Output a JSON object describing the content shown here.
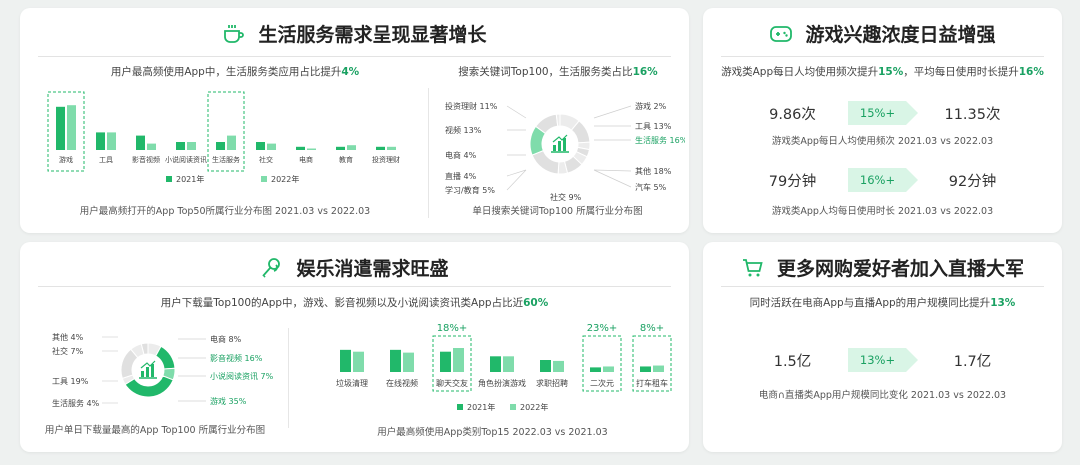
{
  "cards": {
    "services": {
      "title": "生活服务需求呈现显著增长",
      "left_sub_prefix": "用户最高频使用App中，生活服务类应用占比提升",
      "left_sub_highlight": "4%",
      "right_sub_prefix": "搜索关键词Top100，生活服务类占比",
      "right_sub_highlight": "16%",
      "left_caption": "用户最高频打开的App Top50所属行业分布图   2021.03 vs 2022.03",
      "right_caption": "单日搜索关键词Top100 所属行业分布图"
    },
    "games": {
      "title": "游戏兴趣浓度日益增强",
      "sub_prefix1": "游戏类App每日人均使用频次提升",
      "sub_highlight1": "15%",
      "sub_prefix2": "，平均每日使用时长提升",
      "sub_highlight2": "16%",
      "stat1": {
        "from": "9.86次",
        "pct": "15%+",
        "to": "11.35次",
        "caption": "游戏类App每日人均使用频次   2021.03 vs 2022.03"
      },
      "stat2": {
        "from": "79分钟",
        "pct": "16%+",
        "to": "92分钟",
        "caption": "游戏类App人均每日使用时长   2021.03 vs 2022.03"
      }
    },
    "entertainment": {
      "title": "娱乐消遣需求旺盛",
      "sub_prefix": "用户下载量Top100的App中，游戏、影音视频以及小说阅读资讯类App占比近",
      "sub_highlight": "60%",
      "left_caption": "用户单日下载量最高的App Top100 所属行业分布图",
      "right_caption": "用户最高频使用App类别Top15   2022.03 vs 2021.03"
    },
    "livestream": {
      "title": "更多网购爱好者加入直播大军",
      "sub_prefix": "同时活跃在电商App与直播App的用户规模同比提升",
      "sub_highlight": "13%",
      "stat": {
        "from": "1.5亿",
        "pct": "13%+",
        "to": "1.7亿",
        "caption": "电商∩直播类App用户规模同比变化   2021.03 vs 2022.03"
      }
    }
  },
  "colors": {
    "dark": "#21b86a",
    "light": "#7fdcab",
    "accent": "#1aa162",
    "grey": "#e6e6e6"
  },
  "icons": {
    "services": "coffee-cup-icon",
    "games": "gamepad-icon",
    "entertainment": "microphone-icon",
    "livestream": "shopping-cart-icon",
    "center": "bar-chart-icon"
  },
  "chart_data": [
    {
      "type": "bar",
      "categories": [
        "游戏",
        "工具",
        "影音视频",
        "小说阅读资讯",
        "生活服务",
        "社交",
        "电商",
        "教育",
        "投资理财"
      ],
      "highlighted": [
        "游戏",
        "生活服务"
      ],
      "series": [
        {
          "name": "2021年",
          "values": [
            27,
            11,
            9,
            5,
            5,
            5,
            2,
            2,
            2
          ]
        },
        {
          "name": "2022年",
          "values": [
            28,
            11,
            4,
            5,
            9,
            4,
            0,
            3,
            2
          ]
        }
      ],
      "ylim": [
        0,
        30
      ]
    },
    {
      "type": "pie",
      "labels": [
        "投资理财",
        "视频",
        "电商",
        "直播",
        "学习/教育",
        "社交",
        "汽车",
        "其他",
        "生活服务",
        "工具",
        "游戏"
      ],
      "values": [
        11,
        13,
        4,
        4,
        5,
        9,
        5,
        18,
        16,
        13,
        2
      ],
      "display": [
        "11%",
        "13%",
        "4%",
        "4%",
        "5%",
        "9%",
        "5%",
        "18%",
        "16%",
        "13%",
        "2%"
      ],
      "highlight": "生活服务"
    },
    {
      "type": "pie",
      "labels": [
        "电商",
        "影音视频",
        "小说阅读资讯",
        "游戏",
        "生活服务",
        "工具",
        "社交",
        "其他"
      ],
      "values": [
        8,
        16,
        7,
        35,
        4,
        19,
        7,
        4
      ],
      "display": [
        "8%",
        "16%",
        "7%",
        "35%",
        "4%",
        "19%",
        "7%",
        "4%"
      ],
      "highlight": [
        "影音视频",
        "小说阅读资讯",
        "游戏"
      ]
    },
    {
      "type": "bar",
      "categories": [
        "垃圾清理",
        "在线视频",
        "聊天交友",
        "角色扮演游戏",
        "求职招聘",
        "二次元",
        "打车租车"
      ],
      "series": [
        {
          "name": "2021年",
          "values": [
            24,
            24,
            22,
            17,
            13,
            5,
            6
          ]
        },
        {
          "name": "2022年",
          "values": [
            22,
            21,
            26,
            17,
            12,
            6,
            7
          ]
        }
      ],
      "annotations": [
        {
          "category": "聊天交友",
          "text": "18%+"
        },
        {
          "category": "二次元",
          "text": "23%+"
        },
        {
          "category": "打车租车",
          "text": "8%+"
        }
      ]
    }
  ]
}
